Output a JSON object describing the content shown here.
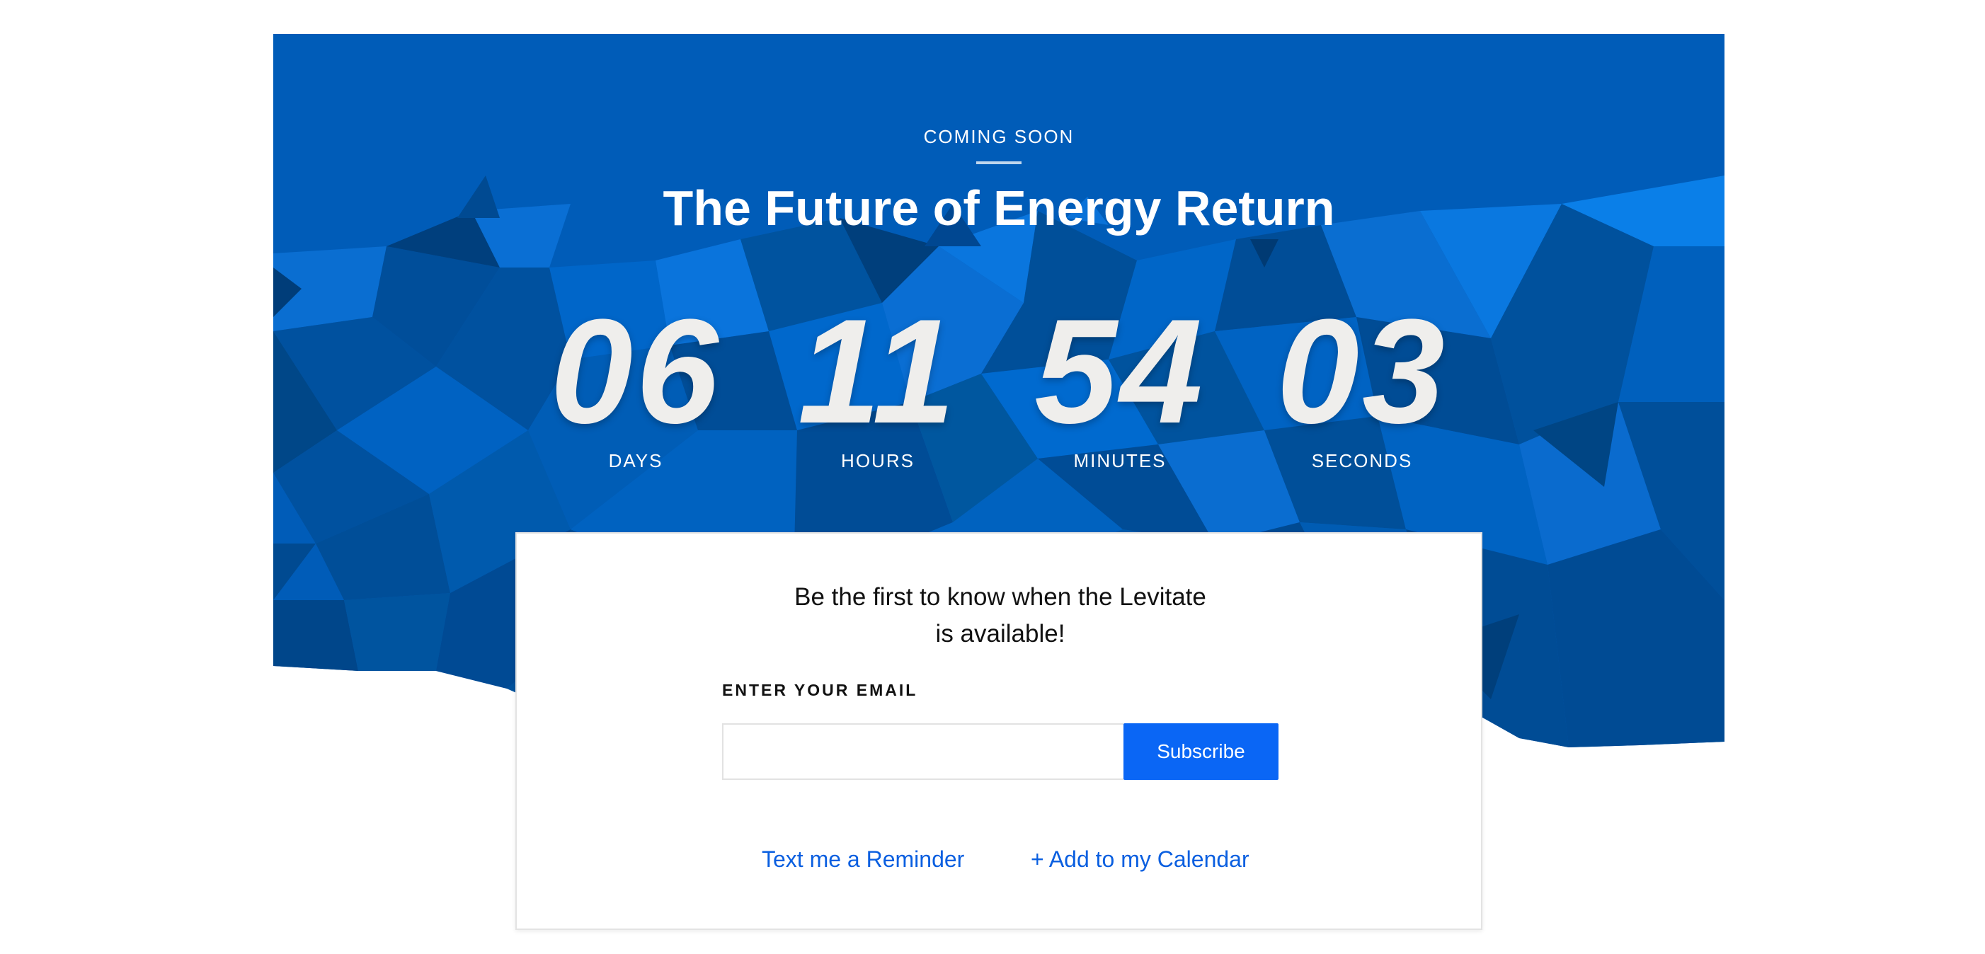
{
  "hero": {
    "kicker": "COMING SOON",
    "title": "The Future of Energy Return",
    "colors": {
      "base": "#005dbb",
      "dark": "#00488f",
      "light": "#0a7be6"
    }
  },
  "countdown": {
    "days": {
      "value": "06",
      "label": "DAYS"
    },
    "hours": {
      "value": "11",
      "label": "HOURS"
    },
    "minutes": {
      "value": "54",
      "label": "MINUTES"
    },
    "seconds": {
      "value": "03",
      "label": "SECONDS"
    }
  },
  "signup": {
    "lead": "Be the first to know when the Levitate is available!",
    "email_label": "ENTER YOUR EMAIL",
    "email_value": "",
    "email_placeholder": "",
    "subscribe_label": "Subscribe",
    "reminder_link": "Text me a Reminder",
    "calendar_link": "+ Add to my Calendar",
    "accent_color": "#0a66f5"
  }
}
